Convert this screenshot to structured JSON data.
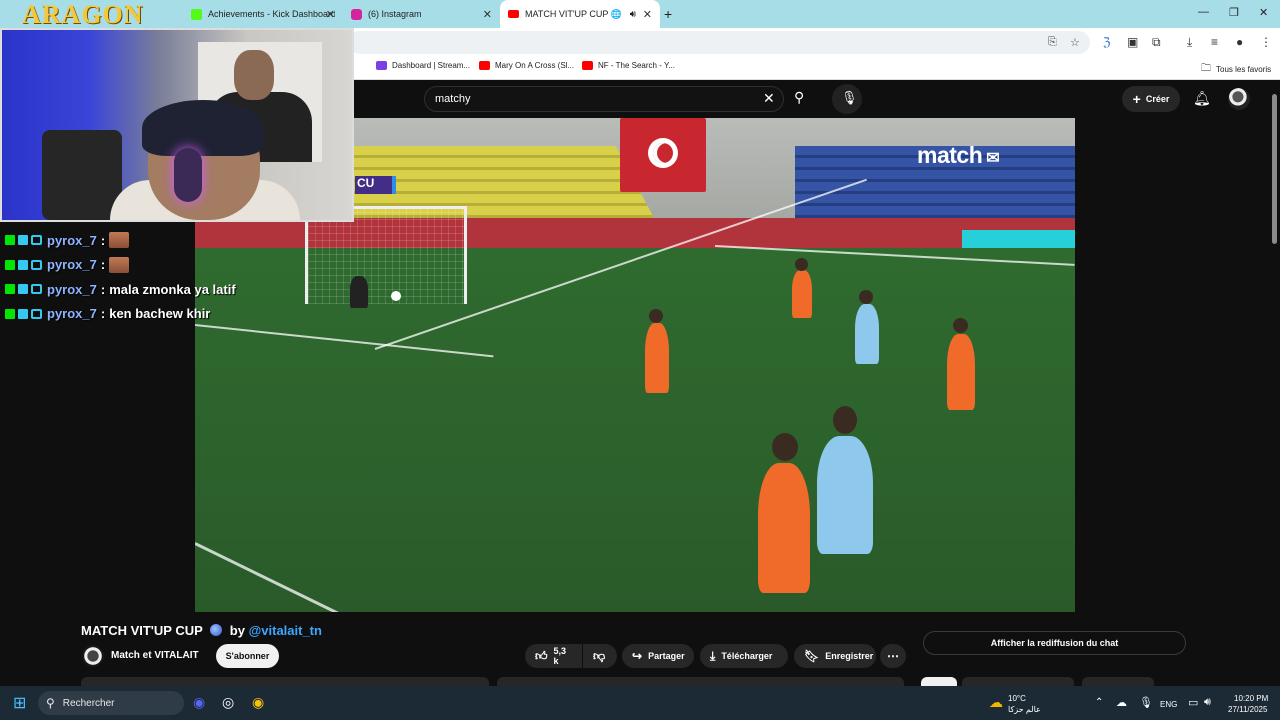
{
  "browser": {
    "tabs": [
      {
        "title": "Achievements - Kick Dashboard",
        "color": "#53fc18"
      },
      {
        "title": "(6) Instagram",
        "color": "#d6249f"
      },
      {
        "title": "MATCH VIT'UP CUP 🌐 by",
        "color": "#ff0000",
        "active": true
      }
    ],
    "new_tab_icon": "plus-icon",
    "window_controls": [
      "minimize-icon",
      "restore-icon",
      "close-icon"
    ],
    "bookmarks": [
      {
        "label": "Dashboard | Stream...",
        "color": "#7b3fe4"
      },
      {
        "label": "Mary On A Cross (Sl...",
        "color": "#ff0000"
      },
      {
        "label": "NF - The Search - Y...",
        "color": "#ff0000"
      }
    ],
    "all_bookmarks": "Tous les favoris"
  },
  "overlay": {
    "logo": "ARAGON",
    "chat": [
      {
        "user": "pyrox_7",
        "message": "",
        "emote": true
      },
      {
        "user": "pyrox_7",
        "message": "",
        "emote": true
      },
      {
        "user": "pyrox_7",
        "message": "mala zmonka ya latif",
        "emote": false
      },
      {
        "user": "pyrox_7",
        "message": "ken bachew khir",
        "emote": false
      }
    ]
  },
  "youtube": {
    "search_value": "matchy",
    "create_label": "Créer",
    "video_overlay": {
      "badge": "CU",
      "brand": "match"
    },
    "title_main": "MATCH VIT'UP CUP",
    "title_by": "by",
    "title_handle": "@vitalait_tn",
    "channel": "Match et VITALAIT",
    "subscribe": "S'abonner",
    "likes": "5,3 k",
    "share": "Partager",
    "download": "Télécharger",
    "save": "Enregistrer",
    "replay_chat": "Afficher la rediffusion du chat"
  },
  "taskbar": {
    "search": "Rechercher",
    "weather_temp": "10°C",
    "weather_text": "عالم حزكا",
    "lang": "ENG",
    "time": "10:20 PM",
    "date": "27/11/2025"
  }
}
